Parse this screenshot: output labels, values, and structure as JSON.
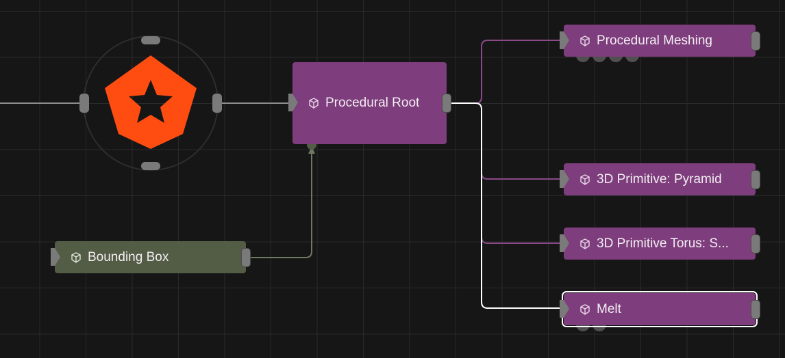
{
  "canvas": {
    "background": "#161616",
    "grid_color": "#2a2a2a"
  },
  "colors": {
    "node_purple": "#7e3d7c",
    "node_green": "#535c45",
    "wire_purple": "#8a4a8a",
    "wire_white": "#ffffff",
    "wire_gray": "#8d8d8d",
    "wire_green": "#6f7862",
    "logo_orange": "#ff4d12"
  },
  "logo": {
    "icon": "gear-star-logo-icon"
  },
  "nodes": {
    "procedural_root": {
      "label": "Procedural Root",
      "icon": "cube-icon"
    },
    "bounding_box": {
      "label": "Bounding Box",
      "icon": "cube-icon"
    },
    "procedural_meshing": {
      "label": "Procedural Meshing",
      "icon": "cube-icon"
    },
    "pyramid": {
      "label": "3D Primitive: Pyramid",
      "icon": "cube-icon"
    },
    "torus": {
      "label": "3D Primitive Torus: S...",
      "icon": "cube-icon"
    },
    "melt": {
      "label": "Melt",
      "icon": "cube-icon",
      "selected": true
    }
  }
}
